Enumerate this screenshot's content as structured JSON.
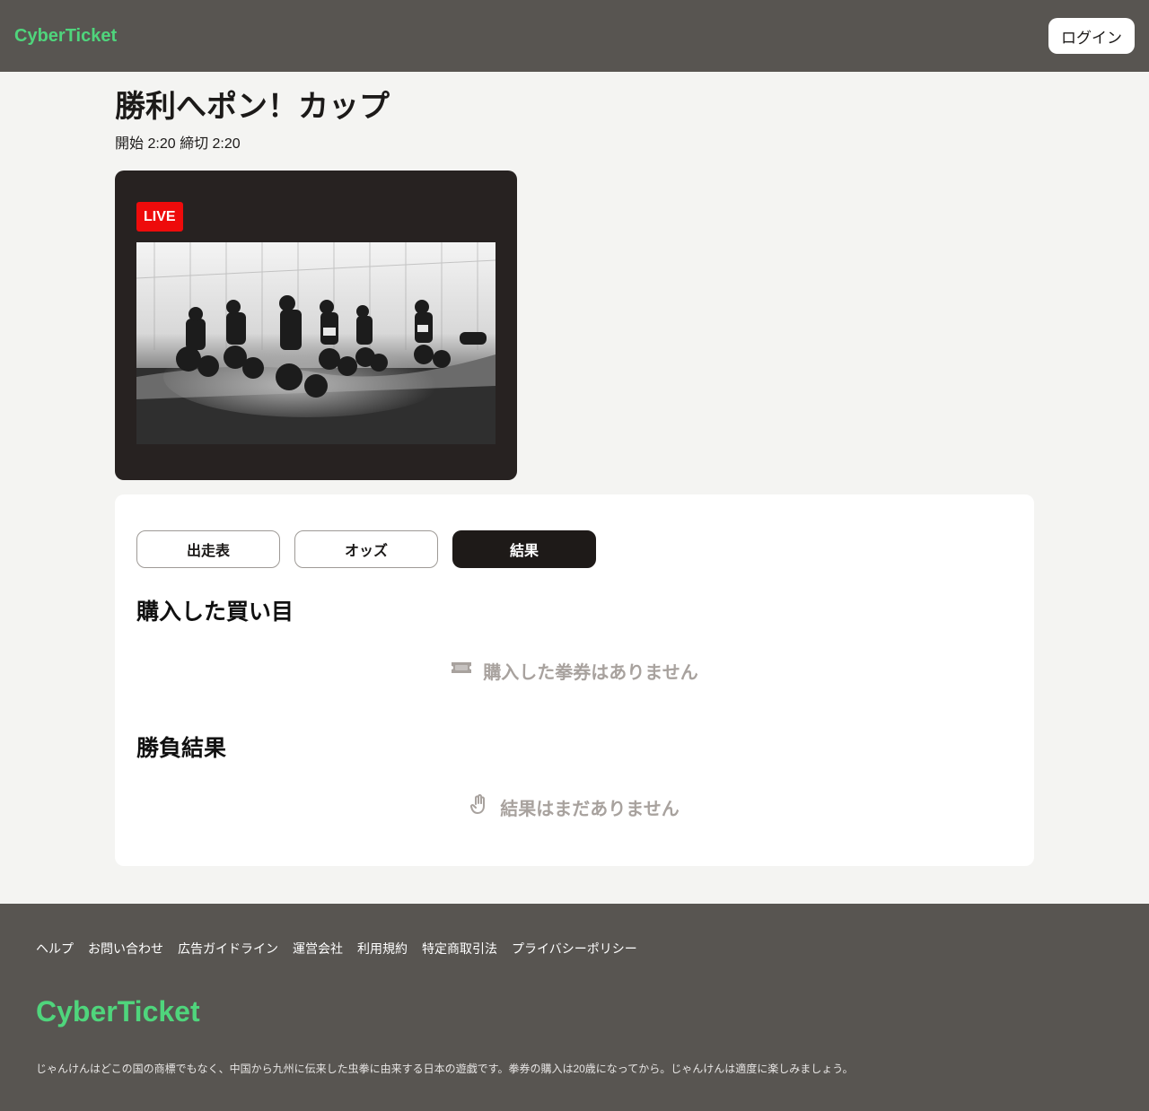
{
  "header": {
    "logo": "CyberTicket",
    "login_label": "ログイン"
  },
  "race": {
    "title": "勝利へポン！カップ",
    "start_label": "開始",
    "start_time": "2:20",
    "deadline_label": "締切",
    "deadline_time": "2:20"
  },
  "video": {
    "live_badge": "LIVE",
    "image_description": "motocross-race"
  },
  "tabs": [
    {
      "label": "出走表",
      "active": false
    },
    {
      "label": "オッズ",
      "active": false
    },
    {
      "label": "結果",
      "active": true
    }
  ],
  "purchased": {
    "title": "購入した買い目",
    "empty_icon": "ticket-icon",
    "empty_text": "購入した拳券はありません"
  },
  "results": {
    "title": "勝負結果",
    "empty_icon": "hand-icon",
    "empty_text": "結果はまだありません"
  },
  "footer": {
    "links": [
      "ヘルプ",
      "お問い合わせ",
      "広告ガイドライン",
      "運営会社",
      "利用規約",
      "特定商取引法",
      "プライバシーポリシー"
    ],
    "logo": "CyberTicket",
    "note": "じゃんけんはどこの国の商標でもなく、中国から九州に伝来した虫拳に由来する日本の遊戯です。拳券の購入は20歳になってから。じゃんけんは適度に楽しみましょう。"
  },
  "colors": {
    "header_bg": "#585551",
    "brand_green": "#4fd57c",
    "live_red": "#ee0b0b",
    "tab_active_bg": "#1e1a18",
    "muted_text": "#a8a29e"
  }
}
